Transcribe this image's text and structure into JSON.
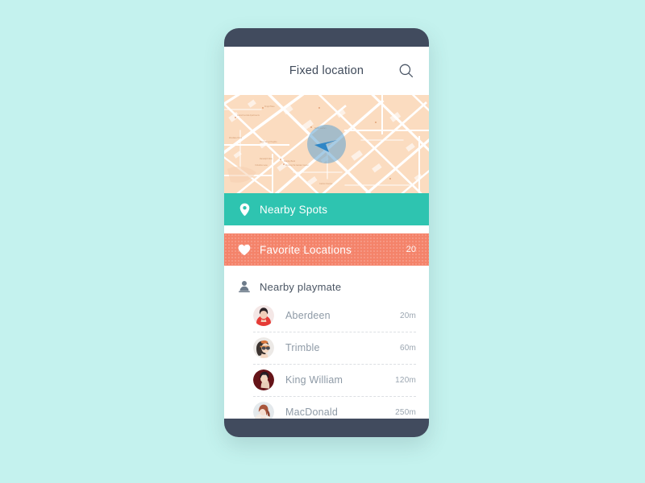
{
  "theme": {
    "page_background": "#c4f2ee",
    "bezel": "#414b5e",
    "screen": "#ffffff",
    "spots_accent": "#2ec4b0",
    "favorites_accent": "#f4836a",
    "map_background": "#fbdcc0",
    "gps_blue": "#2f86c6",
    "name_text": "#8e9aa6",
    "distance_text": "#9aa5b0"
  },
  "topbar": {
    "title": "Fixed location",
    "search_icon": "search-icon"
  },
  "map": {
    "gps_icon": "navigation-arrow-icon",
    "labels": [
      "Grand Central Apartments",
      "Kings Place",
      "Hope Street Heights",
      "Randolph Row",
      "North Garden",
      "Yorkshire Lane",
      "Stanley Bank",
      "Morning Tai Garden Center",
      "Westlake Drive",
      "Canton Avenue"
    ]
  },
  "actions": [
    {
      "id": "nearby-spots",
      "label": "Nearby Spots",
      "icon": "map-pin-icon",
      "count": "",
      "color": "#2ec4b0"
    },
    {
      "id": "favorite-locations",
      "label": "Favorite Locations",
      "icon": "heart-icon",
      "count": "20",
      "color": "#f4836a"
    }
  ],
  "playmate": {
    "header_label": "Nearby playmate",
    "header_icon": "person-icon",
    "items": [
      {
        "name": "Aberdeen",
        "distance": "20m",
        "avatar": "avatar-aberdeen"
      },
      {
        "name": "Trimble",
        "distance": "60m",
        "avatar": "avatar-trimble"
      },
      {
        "name": "King William",
        "distance": "120m",
        "avatar": "avatar-king-william"
      },
      {
        "name": "MacDonald",
        "distance": "250m",
        "avatar": "avatar-macdonald"
      }
    ]
  }
}
